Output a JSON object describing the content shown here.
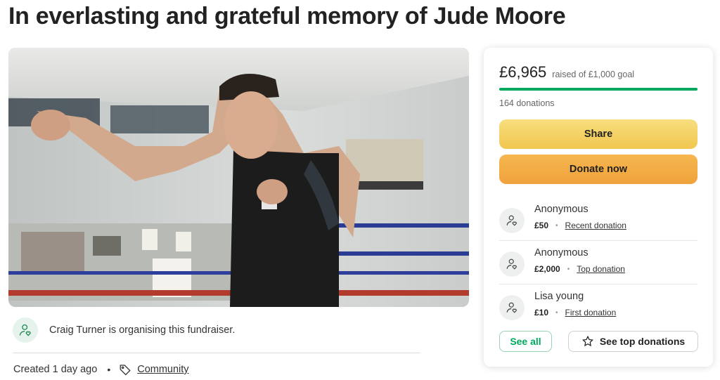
{
  "page": {
    "title": "In everlasting and grateful memory of Jude Moore"
  },
  "hero": {
    "image_kind": "photo-boxer-training-in-gym"
  },
  "organiser": {
    "text": "Craig Turner is organising this fundraiser.",
    "icon": "person-heart-icon"
  },
  "meta": {
    "created": "Created 1 day ago",
    "category": "Community",
    "dot": "•",
    "category_icon": "tag-icon"
  },
  "donation_card": {
    "amount_raised": "£6,965",
    "goal_text": "raised of £1,000 goal",
    "progress_fraction": 1.0,
    "donations_count": "164 donations",
    "share_label": "Share",
    "donate_label": "Donate now",
    "recent": [
      {
        "name": "Anonymous",
        "amount": "£50",
        "type": "Recent donation"
      },
      {
        "name": "Anonymous",
        "amount": "£2,000",
        "type": "Top donation"
      },
      {
        "name": "Lisa young",
        "amount": "£10",
        "type": "First donation"
      }
    ],
    "separator": "•",
    "see_all_label": "See all",
    "see_top_label": "See top donations"
  },
  "colors": {
    "accent_green": "#02a95c",
    "share_yellow": "#f3cf5e",
    "donate_orange": "#f2a941"
  }
}
